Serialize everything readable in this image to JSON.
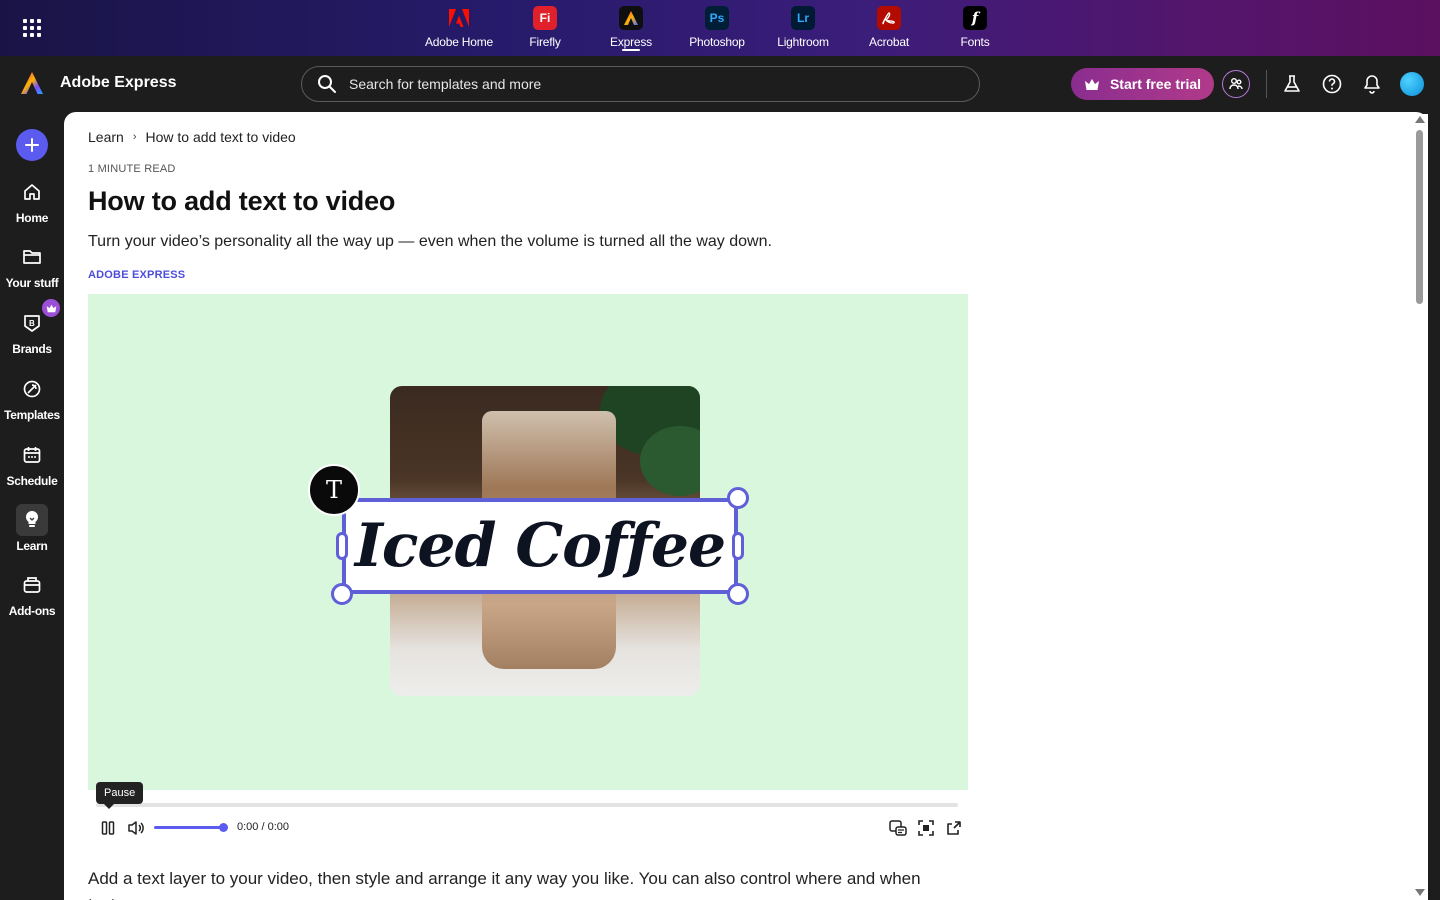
{
  "appbar": {
    "apps": [
      {
        "label": "Adobe Home",
        "icon": "adobe-icon",
        "color": "#e0202a"
      },
      {
        "label": "Firefly",
        "icon": "firefly-icon",
        "abbr": "Fi",
        "color": "#e0202a"
      },
      {
        "label": "Express",
        "icon": "express-icon",
        "color": "#0f0f0f"
      },
      {
        "label": "Photoshop",
        "icon": "photoshop-icon",
        "abbr": "Ps",
        "color": "#001e36"
      },
      {
        "label": "Lightroom",
        "icon": "lightroom-icon",
        "abbr": "Lr",
        "color": "#001a33"
      },
      {
        "label": "Acrobat",
        "icon": "acrobat-icon",
        "color": "#b30b00"
      },
      {
        "label": "Fonts",
        "icon": "fonts-icon",
        "abbr": "f",
        "color": "#000000"
      }
    ],
    "active_app": "Express"
  },
  "header": {
    "brand_name": "Adobe Express",
    "search_placeholder": "Search for templates and more",
    "trial_label": "Start free trial"
  },
  "rail": {
    "items": [
      {
        "label": "Home",
        "icon": "home-icon"
      },
      {
        "label": "Your stuff",
        "icon": "folder-icon"
      },
      {
        "label": "Brands",
        "icon": "brand-icon"
      },
      {
        "label": "Templates",
        "icon": "templates-icon"
      },
      {
        "label": "Schedule",
        "icon": "calendar-icon"
      },
      {
        "label": "Learn",
        "icon": "lightbulb-icon"
      },
      {
        "label": "Add-ons",
        "icon": "addons-icon"
      }
    ],
    "active": "Learn"
  },
  "article": {
    "breadcrumb": [
      "Learn",
      "How to add text to video"
    ],
    "read_time": "1 MINUTE READ",
    "title": "How to add text to video",
    "subtitle": "Turn your video’s personality all the way up — even when the volume is turned all the way down.",
    "tag": "ADOBE EXPRESS",
    "video": {
      "overlay_text": "Iced Coffee",
      "text_tool_glyph": "T",
      "tooltip": "Pause",
      "time": "0:00 / 0:00",
      "progress": 0,
      "volume": 1.0,
      "background": "#d9f7dc"
    },
    "body": "Add a text layer to your video, then style and arrange it any way you like. You can also control where and when text"
  },
  "colors": {
    "accent": "#5b5bf0",
    "trial_gradient_start": "#8a2d8f",
    "trial_gradient_end": "#b13a8a"
  }
}
